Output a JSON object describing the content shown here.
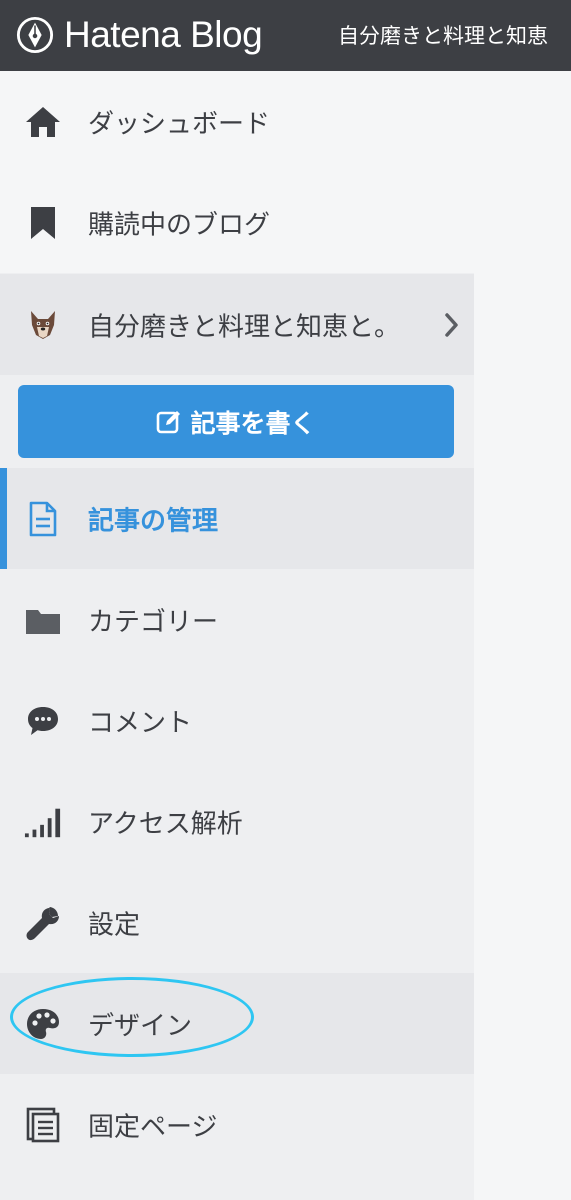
{
  "header": {
    "logo_text": "Hatena Blog",
    "blog_title": "自分磨きと料理と知恵"
  },
  "nav": {
    "dashboard": "ダッシュボード",
    "subscribed": "購読中のブログ",
    "blog_name": "自分磨きと料理と知恵と。",
    "write_button": "記事を書く",
    "manage_entries": "記事の管理",
    "category": "カテゴリー",
    "comment": "コメント",
    "analytics": "アクセス解析",
    "settings": "設定",
    "design": "デザイン",
    "static_pages": "固定ページ"
  },
  "colors": {
    "header_bg": "#3d3f44",
    "accent": "#3692dc",
    "highlight": "#2ec6f2",
    "sidebar_bg": "#eeeff1"
  },
  "icons": [
    "pen-logo-icon",
    "home-icon",
    "bookmark-icon",
    "dog-avatar-icon",
    "chevron-right-icon",
    "edit-icon",
    "document-icon",
    "folder-icon",
    "comment-icon",
    "signal-bars-icon",
    "wrench-icon",
    "palette-icon",
    "pages-icon"
  ]
}
